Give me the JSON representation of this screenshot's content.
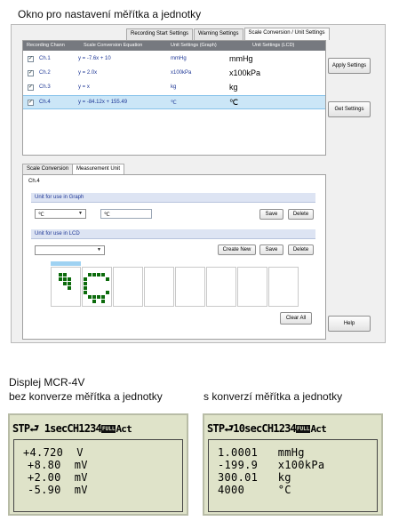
{
  "window_caption": "Okno pro nastavení měřítka a jednotky",
  "tabs": [
    "Recording Start Settings",
    "Warning Settings",
    "Scale Conversion / Unit Settings"
  ],
  "table": {
    "headers": [
      "Recording Chann",
      "Scale Conversion Equation",
      "Unit Settings (Graph)",
      "Unit Settings (LCD)"
    ],
    "rows": [
      {
        "check": "✓",
        "channel": "Ch.1",
        "equation": "y = -7.6x + 10",
        "graph_unit": "mmHg",
        "lcd_unit": "mmHg",
        "selected": false
      },
      {
        "check": "✓",
        "channel": "Ch.2",
        "equation": "y = 2.0x",
        "graph_unit": "x100kPa",
        "lcd_unit": "x100kPa",
        "selected": false
      },
      {
        "check": "✓",
        "channel": "Ch.3",
        "equation": "y = x",
        "graph_unit": "kg",
        "lcd_unit": "kg",
        "selected": false
      },
      {
        "check": "✓",
        "channel": "Ch.4",
        "equation": "y = -84.12x + 155.49",
        "graph_unit": "℃",
        "lcd_unit": "℃",
        "selected": true
      }
    ]
  },
  "side_buttons": {
    "apply": "Apply Settings",
    "get": "Get Settings",
    "help": "Help"
  },
  "lower_tabs": [
    "Scale Conversion",
    "Measurement Unit"
  ],
  "channel_label": "Ch.4",
  "graph_group": {
    "title": "Unit for use in Graph",
    "combo_value": "℃",
    "text_value": "℃",
    "save": "Save",
    "delete": "Delete"
  },
  "lcd_group": {
    "title": "Unit for use in LCD",
    "combo_value": "",
    "create": "Create New",
    "save": "Save",
    "delete": "Delete"
  },
  "clear_all": "Clear All",
  "display_caption_line1": "Displej MCR-4V",
  "display_caption_line2": "bez konverze měřítka a jednotky",
  "display_caption_right": "s konverzí měřítka a jednotky",
  "lcd_left": {
    "stp": "STP",
    "interval": " 1sec",
    "channels": "CH1234",
    "full": "FULL",
    "act": "Act",
    "lines": [
      "+4.720  V",
      "  +8.80  mV",
      "  +2.00  mV",
      "  -5.90  mV"
    ]
  },
  "lcd_right": {
    "stp": "STP",
    "interval": "10sec",
    "channels": "CH1234",
    "full": "FULL",
    "act": "Act",
    "lines": [
      "1.0001   mmHg",
      "-199.9   x100kPa",
      "300.01   kg",
      "4000     °C"
    ]
  }
}
